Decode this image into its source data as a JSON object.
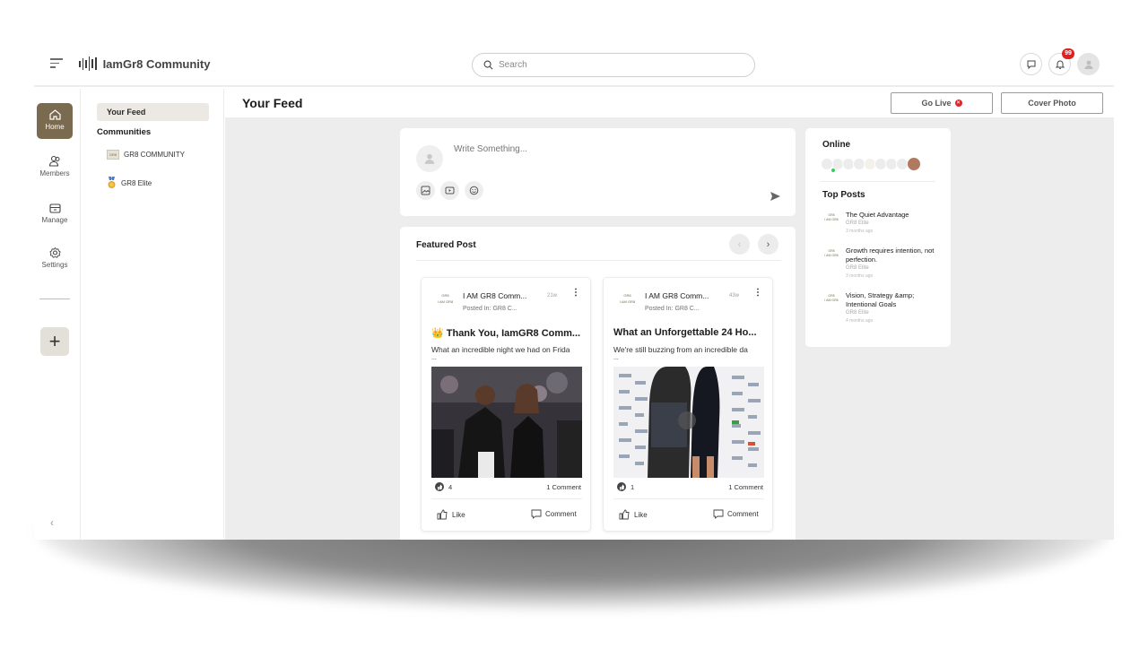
{
  "header": {
    "brand": "IamGr8 Community",
    "search_placeholder": "Search",
    "notifications_count": "99"
  },
  "rail": {
    "home": "Home",
    "members": "Members",
    "manage": "Manage",
    "settings": "Settings"
  },
  "communities_panel": {
    "your_feed": "Your Feed",
    "heading": "Communities",
    "items": [
      {
        "name": "GR8 COMMUNITY",
        "icon": "gr8-logo-icon"
      },
      {
        "name": "GR8 Elite",
        "icon": "medal-icon"
      }
    ]
  },
  "main": {
    "title": "Your Feed",
    "go_live": "Go Live",
    "cover_photo": "Cover Photo"
  },
  "composer": {
    "placeholder": "Write Something..."
  },
  "featured": {
    "title": "Featured Post",
    "posts": [
      {
        "author": "I AM GR8 Comm...",
        "time": "21w",
        "posted_in": "Posted In: GR8 C...",
        "title": "👑 Thank You, IamGR8 Comm...",
        "text": "What an incredible night we had on Frida",
        "ellipsis": "...",
        "reactions": "4",
        "comments": "1 Comment",
        "like": "Like",
        "comment": "Comment"
      },
      {
        "author": "I AM GR8 Comm...",
        "time": "43w",
        "posted_in": "Posted In: GR8 C...",
        "title": "What an Unforgettable 24 Ho...",
        "text": "We're still buzzing from an incredible da",
        "ellipsis": "...",
        "reactions": "1",
        "comments": "1 Comment",
        "like": "Like",
        "comment": "Comment"
      }
    ]
  },
  "sidebar_right": {
    "online_title": "Online",
    "top_posts_title": "Top Posts",
    "top_posts": [
      {
        "title": "The Quiet Advantage",
        "community": "GR8 Elite",
        "time": "3 months ago"
      },
      {
        "title": "Growth requires intention, not perfection.",
        "community": "GR8 Elite",
        "time": "3 months ago"
      },
      {
        "title": "Vision, Strategy &amp; Intentional Goals",
        "community": "GR8 Elite",
        "time": "4 months ago"
      }
    ]
  },
  "colors": {
    "accent_brown": "#7a6a50",
    "badge_red": "#e02020",
    "online_green": "#2fd15e"
  }
}
